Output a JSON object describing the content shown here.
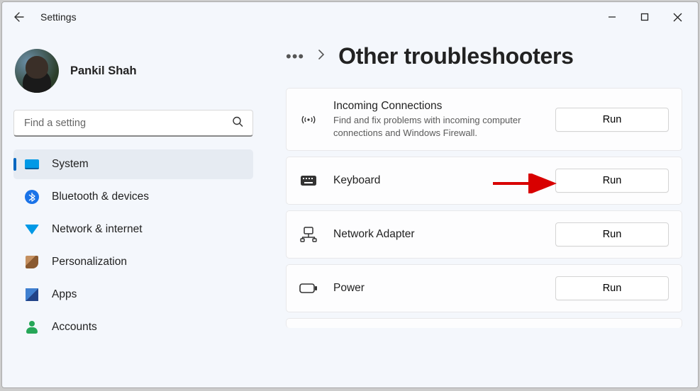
{
  "window": {
    "title": "Settings"
  },
  "profile": {
    "name": "Pankil Shah"
  },
  "search": {
    "placeholder": "Find a setting"
  },
  "sidebar": {
    "items": [
      {
        "label": "System",
        "icon": "monitor",
        "active": true
      },
      {
        "label": "Bluetooth & devices",
        "icon": "bluetooth"
      },
      {
        "label": "Network & internet",
        "icon": "wifi"
      },
      {
        "label": "Personalization",
        "icon": "brush"
      },
      {
        "label": "Apps",
        "icon": "apps"
      },
      {
        "label": "Accounts",
        "icon": "account"
      }
    ]
  },
  "main": {
    "heading": "Other troubleshooters",
    "run_label": "Run",
    "troubleshooters": [
      {
        "title": "Incoming Connections",
        "desc": "Find and fix problems with incoming computer connections and Windows Firewall.",
        "icon": "broadcast"
      },
      {
        "title": "Keyboard",
        "desc": "",
        "icon": "keyboard"
      },
      {
        "title": "Network Adapter",
        "desc": "",
        "icon": "network-adapter"
      },
      {
        "title": "Power",
        "desc": "",
        "icon": "power"
      }
    ]
  }
}
